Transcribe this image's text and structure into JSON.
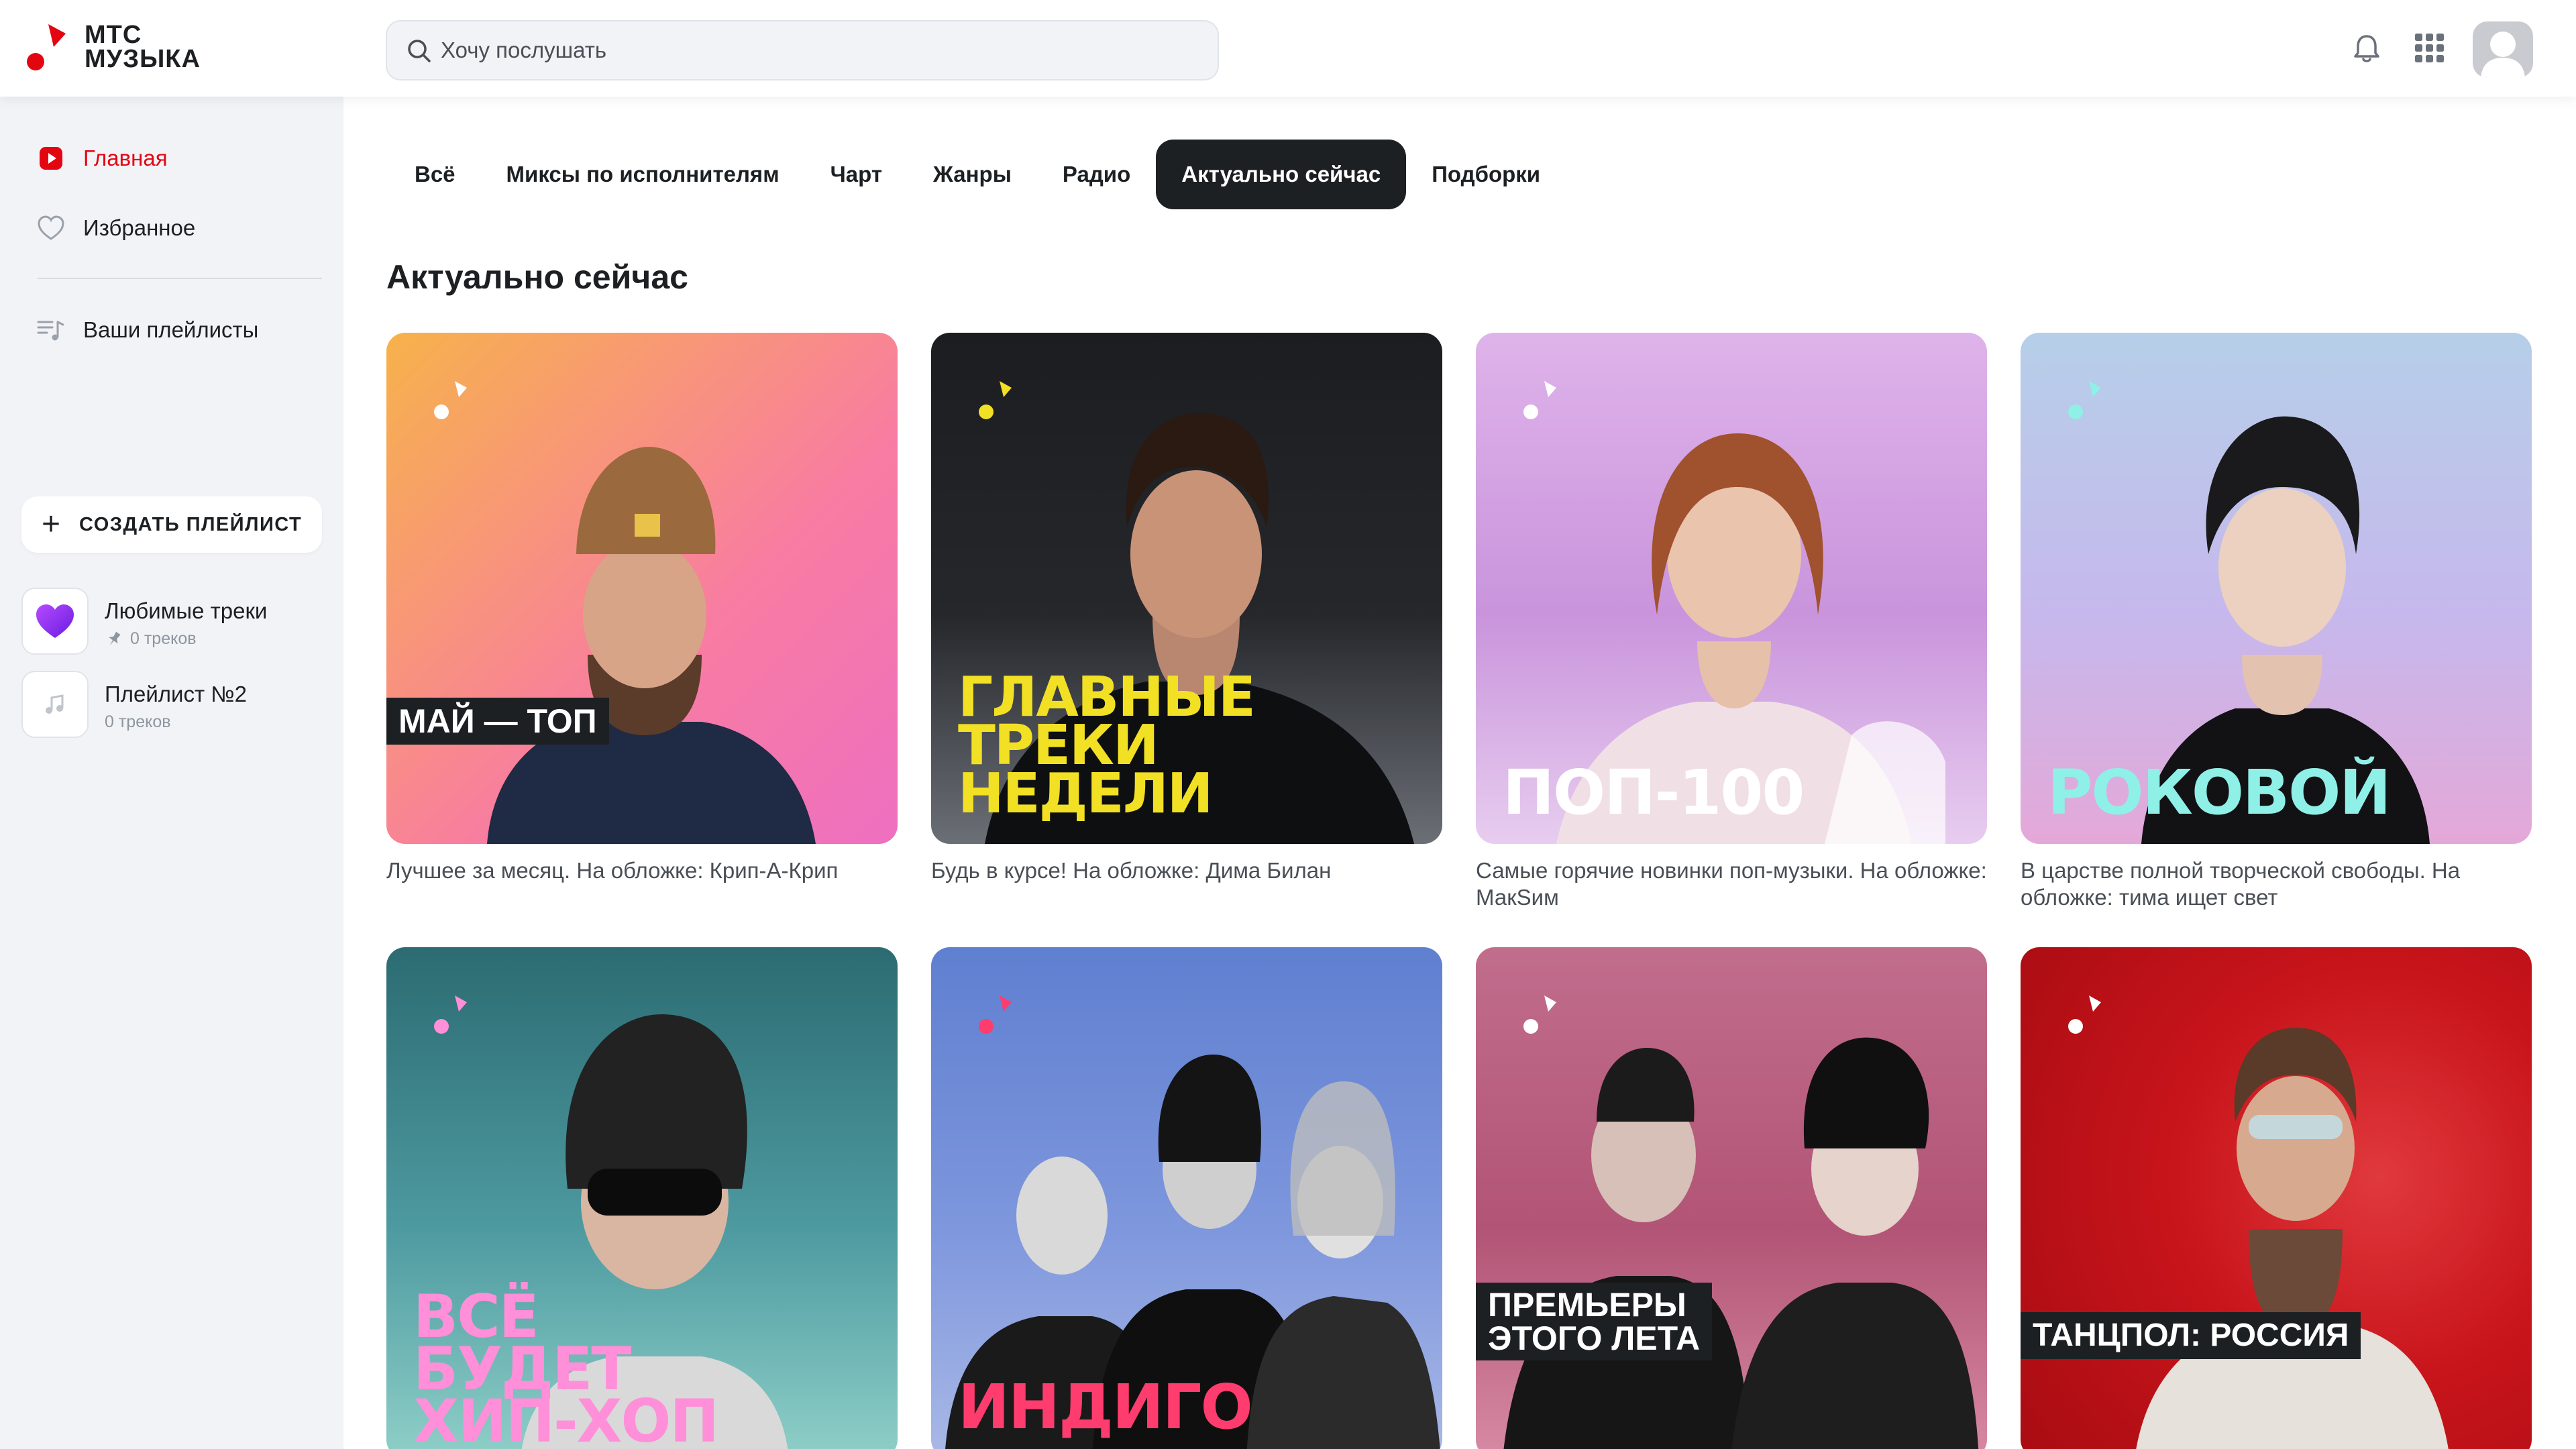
{
  "app": {
    "logo_text": "МТС\nМУЗЫКА",
    "brand_color": "#e30611"
  },
  "search": {
    "placeholder": "Хочу послушать",
    "value": ""
  },
  "header_icons": [
    "bell-icon",
    "apps-grid-icon",
    "avatar"
  ],
  "sidebar": {
    "nav": [
      {
        "label": "Главная",
        "icon": "play-icon",
        "active": true
      },
      {
        "label": "Избранное",
        "icon": "heart-icon",
        "active": false
      },
      {
        "label": "Ваши плейлисты",
        "icon": "playlist-icon",
        "active": false
      }
    ],
    "create_playlist_label": "СОЗДАТЬ ПЛЕЙЛИСТ",
    "playlists": [
      {
        "title": "Любимые треки",
        "subtitle": "0 треков",
        "icon": "heart-icon"
      },
      {
        "title": "Плейлист №2",
        "subtitle": "0 треков",
        "icon": "music-note-icon"
      }
    ]
  },
  "tabs": [
    {
      "label": "Всё",
      "active": false
    },
    {
      "label": "Миксы по исполнителям",
      "active": false
    },
    {
      "label": "Чарт",
      "active": false
    },
    {
      "label": "Жанры",
      "active": false
    },
    {
      "label": "Радио",
      "active": false
    },
    {
      "label": "Актуально сейчас",
      "active": true
    },
    {
      "label": "Подборки",
      "active": false
    }
  ],
  "section_title": "Актуально сейчас",
  "cards": [
    {
      "cover_title": "МАЙ — ТОП",
      "description": "Лучшее за месяц. На обложке: Крип-А-Крип",
      "colors": [
        "#f7b24b",
        "#f87ca2",
        "#ee6fc0"
      ]
    },
    {
      "cover_title": "ГЛАВНЫЕ\nТРЕКИ\nНЕДЕЛИ",
      "description": "Будь в курсе! На обложке: Дима Билан",
      "colors": [
        "#1c1d20",
        "#2b2d32",
        "#6b6f76"
      ]
    },
    {
      "cover_title": "ПОП-100",
      "description": "Самые горячие новинки поп-музыки. На обложке: МакSим",
      "colors": [
        "#d5a8e6",
        "#c58fd6",
        "#e3c5ee"
      ]
    },
    {
      "cover_title": "РОКОВОЙ",
      "description": "В царстве полной творческой свободы. На обложке: тима ищет свет",
      "colors": [
        "#b6cfe9",
        "#c5b7ec",
        "#e2a9d9"
      ]
    },
    {
      "cover_title": "ВСЁ\nБУДЕТ\nХИП-ХОП",
      "description": "",
      "colors": [
        "#2c6b72",
        "#4d9aa0",
        "#8fcfc8"
      ]
    },
    {
      "cover_title": "ИНДИГО",
      "description": "",
      "colors": [
        "#5f7fd0",
        "#7e97dd",
        "#a9b8e6"
      ]
    },
    {
      "cover_title": "ПРЕМЬЕРЫ\nЭТОГО ЛЕТА",
      "description": "",
      "colors": [
        "#c16d8c",
        "#b25475",
        "#d78aa4"
      ]
    },
    {
      "cover_title": "ТАНЦПОЛ: РОССИЯ",
      "description": "",
      "colors": [
        "#d01a20",
        "#b30f15",
        "#e0393d"
      ]
    }
  ]
}
